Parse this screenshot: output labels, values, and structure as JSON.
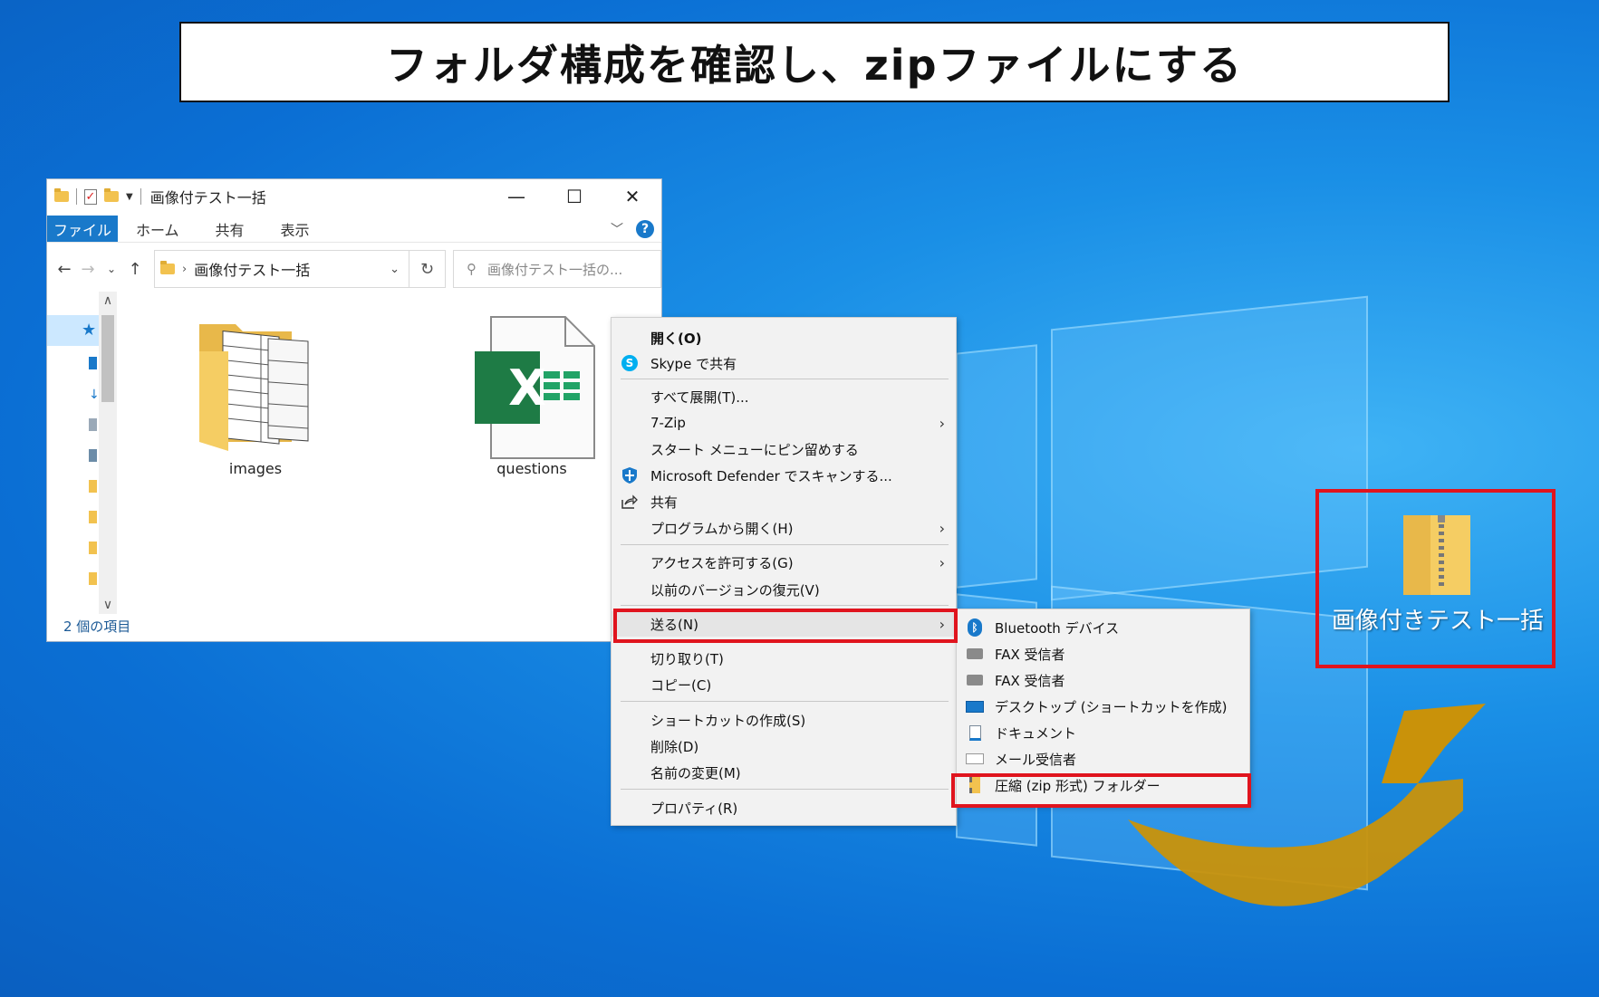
{
  "title": "フォルダ構成を確認し、zipファイルにする",
  "explorer": {
    "window_title": "画像付テスト一括",
    "controls": {
      "minimize": "—",
      "maximize": "☐",
      "close": "✕"
    },
    "ribbon_tabs": [
      "ファイル",
      "ホーム",
      "共有",
      "表示"
    ],
    "help": "?",
    "address": "画像付テスト一括",
    "search_placeholder": "画像付テスト一括の...",
    "files": [
      {
        "name": "images",
        "icon": "folder-icon"
      },
      {
        "name": "questions",
        "icon": "excel-icon"
      }
    ],
    "status": "2 個の項目",
    "excel_glyph": "X"
  },
  "context_menu": {
    "items": [
      {
        "label": "開く(O)",
        "bold": true
      },
      {
        "label": "Skype で共有",
        "icon": "skype-icon"
      },
      {
        "label": "すべて展開(T)..."
      },
      {
        "label": "7-Zip",
        "submenu": true
      },
      {
        "label": "スタート メニューにピン留めする"
      },
      {
        "label": "Microsoft Defender でスキャンする...",
        "icon": "defender-shield-icon"
      },
      {
        "label": "共有",
        "icon": "share-icon"
      },
      {
        "label": "プログラムから開く(H)",
        "submenu": true
      },
      {
        "label": "アクセスを許可する(G)",
        "submenu": true
      },
      {
        "label": "以前のバージョンの復元(V)"
      },
      {
        "label": "送る(N)",
        "submenu": true,
        "highlighted": true
      },
      {
        "label": "切り取り(T)"
      },
      {
        "label": "コピー(C)"
      },
      {
        "label": "ショートカットの作成(S)"
      },
      {
        "label": "削除(D)"
      },
      {
        "label": "名前の変更(M)"
      },
      {
        "label": "プロパティ(R)"
      }
    ]
  },
  "send_to_menu": {
    "items": [
      {
        "label": "Bluetooth デバイス",
        "icon": "bluetooth-icon"
      },
      {
        "label": "FAX 受信者",
        "icon": "fax-icon"
      },
      {
        "label": "FAX 受信者",
        "icon": "fax-icon"
      },
      {
        "label": "デスクトップ (ショートカットを作成)",
        "icon": "desktop-icon"
      },
      {
        "label": "ドキュメント",
        "icon": "documents-icon"
      },
      {
        "label": "メール受信者",
        "icon": "mail-icon"
      },
      {
        "label": "圧縮 (zip 形式) フォルダー",
        "icon": "zip-folder-icon",
        "highlighted": true
      }
    ]
  },
  "desktop_icon": {
    "label": "画像付きテスト一括",
    "icon": "zip-folder-icon"
  },
  "colors": {
    "highlight_red": "#e0141e",
    "arrow": "#c9920a",
    "file_tab": "#1979ca"
  }
}
